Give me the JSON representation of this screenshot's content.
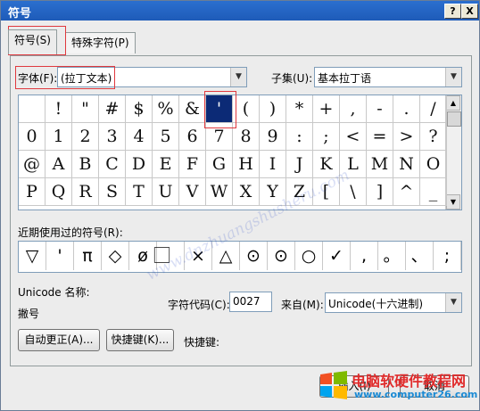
{
  "window": {
    "title": "符号",
    "help_btn": "?",
    "close_btn": "X"
  },
  "tabs": [
    {
      "label": "符号(S)"
    },
    {
      "label": "特殊字符(P)"
    }
  ],
  "font": {
    "label": "字体(F):",
    "value": "(拉丁文本)"
  },
  "subset": {
    "label": "子集(U):",
    "value": "基本拉丁语"
  },
  "symbols": [
    [
      "",
      "!",
      "\"",
      "#",
      "$",
      "%",
      "&",
      "'",
      "(",
      ")",
      "*",
      "+",
      ",",
      "-",
      ".",
      "/"
    ],
    [
      "0",
      "1",
      "2",
      "3",
      "4",
      "5",
      "6",
      "7",
      "8",
      "9",
      ":",
      ";",
      "<",
      "=",
      ">",
      "?"
    ],
    [
      "@",
      "A",
      "B",
      "C",
      "D",
      "E",
      "F",
      "G",
      "H",
      "I",
      "J",
      "K",
      "L",
      "M",
      "N",
      "O"
    ],
    [
      "P",
      "Q",
      "R",
      "S",
      "T",
      "U",
      "V",
      "W",
      "X",
      "Y",
      "Z",
      "[",
      "\\",
      "]",
      "^",
      "_"
    ]
  ],
  "recent_label": "近期使用过的符号(R):",
  "recent_symbols": [
    "▽",
    "'",
    "π",
    "◇",
    "ø",
    "⃞⃞",
    "×",
    "△",
    "⊙",
    "⊙",
    "○",
    "✓",
    ",",
    "。",
    "、",
    ";"
  ],
  "unicode_name_label": "Unicode 名称:",
  "unicode_name_value": "撇号",
  "char_code_label": "字符代码(C):",
  "char_code_value": "0027",
  "from_label": "来自(M):",
  "from_value": "Unicode(十六进制)",
  "autocorrect_btn": "自动更正(A)...",
  "shortcut_btn": "快捷键(K)...",
  "shortcut_label": "快捷键:",
  "insert_btn": "插入(I)",
  "cancel_btn": "取消",
  "watermark": {
    "url": "www.dnzhuangshusheru.com",
    "brand": "电脑软硬件教程网",
    "site": "www.computer26.com"
  },
  "colors": {
    "title_bar": "#1e5bb8",
    "selection": "#0c2a76",
    "highlight": "#e0393e"
  }
}
